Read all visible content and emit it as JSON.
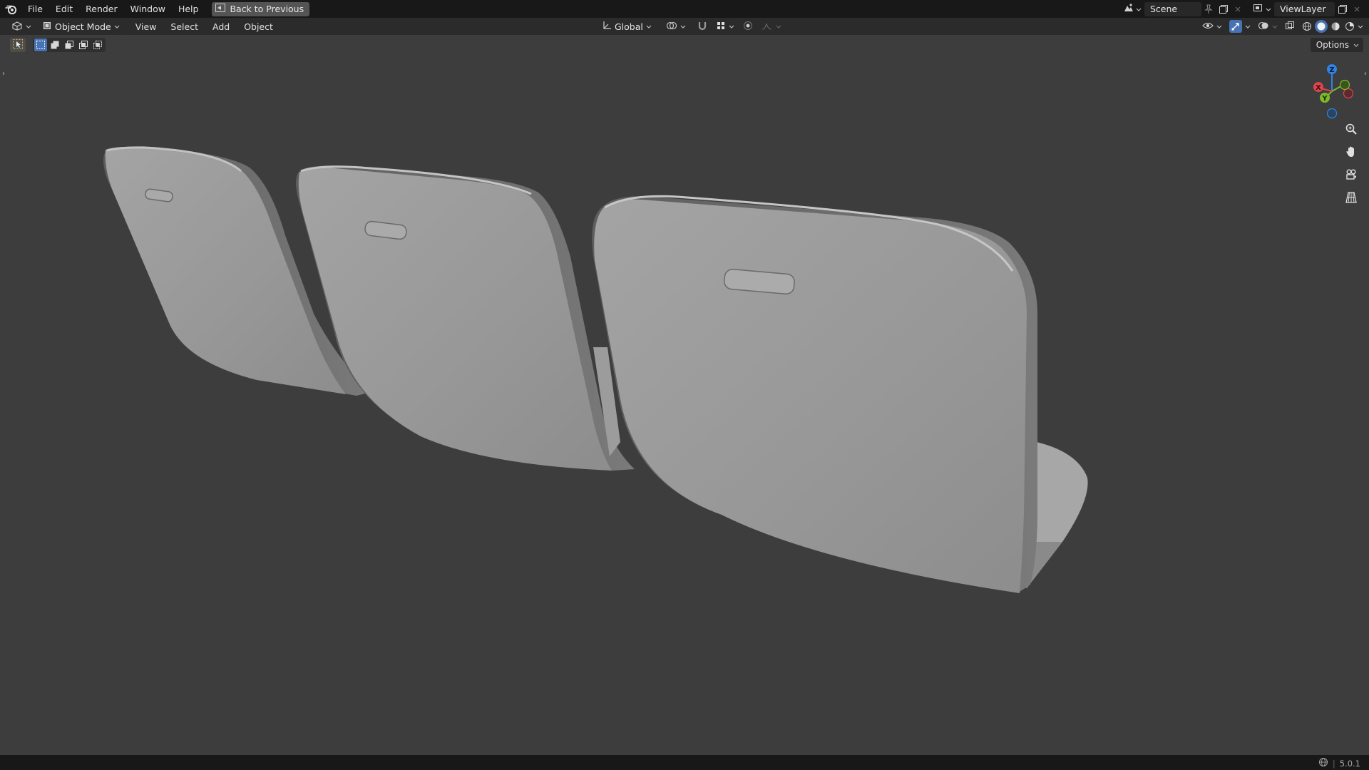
{
  "topbar": {
    "logo": "blender-logo-icon",
    "menus": [
      "File",
      "Edit",
      "Render",
      "Window",
      "Help"
    ],
    "back_button": "Back to Previous",
    "scene": "Scene",
    "view_layer": "ViewLayer"
  },
  "header": {
    "editor_type_icon": "viewport-3d-icon",
    "mode": "Object Mode",
    "menus": [
      "View",
      "Select",
      "Add",
      "Object"
    ],
    "transform_orientation": "Global"
  },
  "toolbar": {
    "options_label": "Options"
  },
  "gizmo": {
    "x": "X",
    "y": "Y",
    "z": "Z"
  },
  "status": {
    "version": "5.0.1"
  },
  "colors": {
    "accent": "#4772b3",
    "background": "#3d3d3d",
    "axis_x": "#e0444d",
    "axis_y": "#7fb929",
    "axis_z": "#2f82e6"
  }
}
